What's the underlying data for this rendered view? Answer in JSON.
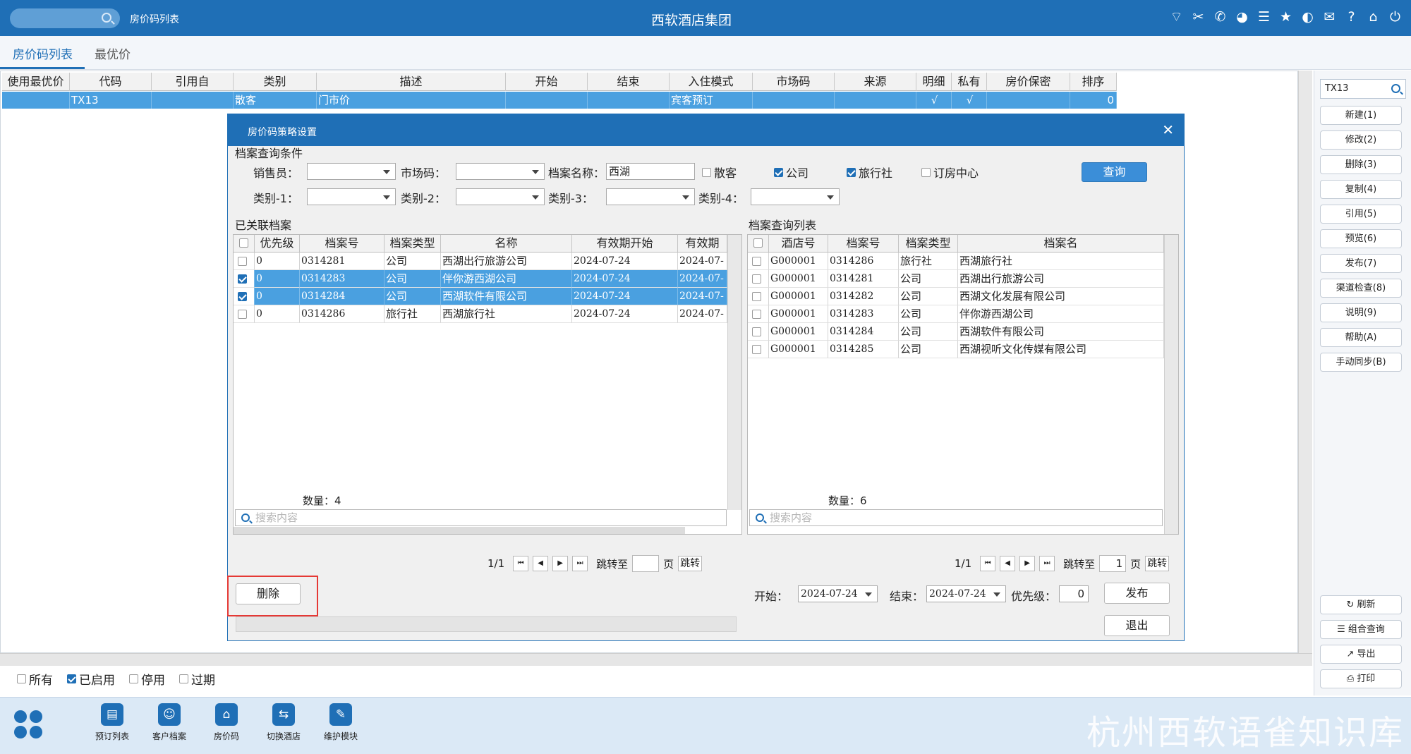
{
  "titlebar": {
    "tab": "房价码列表",
    "center_title": "西软酒店集团",
    "icons": [
      "wifi-icon",
      "tools-icon",
      "phone-icon",
      "palette-icon",
      "menu-icon",
      "star-icon",
      "moon-icon",
      "mail-icon",
      "help-icon",
      "home-icon",
      "power-icon"
    ]
  },
  "tabs": [
    "房价码列表",
    "最优价"
  ],
  "grid": {
    "headers": [
      "使用最优价",
      "代码",
      "引用自",
      "类别",
      "描述",
      "开始",
      "结束",
      "入住模式",
      "市场码",
      "来源",
      "明细",
      "私有",
      "房价保密",
      "排序"
    ],
    "row": [
      "",
      "TX13",
      "",
      "散客",
      "门市价",
      "",
      "",
      "宾客预订",
      "",
      "",
      "√",
      "√",
      "",
      "0"
    ]
  },
  "filters": [
    {
      "label": "所有",
      "checked": false
    },
    {
      "label": "已启用",
      "checked": true
    },
    {
      "label": "停用",
      "checked": false
    },
    {
      "label": "过期",
      "checked": false
    }
  ],
  "right": {
    "search": "TX13",
    "buttons": [
      "新建(1)",
      "修改(2)",
      "删除(3)",
      "复制(4)",
      "引用(5)",
      "预览(6)",
      "发布(7)",
      "渠道检查(8)",
      "说明(9)",
      "帮助(A)",
      "手动同步(B)"
    ],
    "bottom_buttons": [
      "刷新",
      "组合查询",
      "导出",
      "打印"
    ]
  },
  "dialog": {
    "title": "房价码策略设置",
    "query_section": "档案查询条件",
    "labels": {
      "salesman": "销售员：",
      "market": "市场码：",
      "archive_name": "档案名称：",
      "cat1": "类别-1：",
      "cat2": "类别-2：",
      "cat3": "类别-3：",
      "cat4": "类别-4："
    },
    "archive_name_value": "西湖",
    "checks": [
      {
        "label": "散客",
        "checked": false
      },
      {
        "label": "公司",
        "checked": true
      },
      {
        "label": "旅行社",
        "checked": true
      },
      {
        "label": "订房中心",
        "checked": false
      }
    ],
    "query_button": "查询",
    "left_panel": {
      "title": "已关联档案",
      "headers": [
        "优先级",
        "档案号",
        "档案类型",
        "名称",
        "有效期开始",
        "有效期"
      ],
      "rows": [
        {
          "checked": false,
          "selected": false,
          "cells": [
            "0",
            "0314281",
            "公司",
            "西湖出行旅游公司",
            "2024-07-24",
            "2024-07-"
          ]
        },
        {
          "checked": true,
          "selected": true,
          "cells": [
            "0",
            "0314283",
            "公司",
            "伴你游西湖公司",
            "2024-07-24",
            "2024-07-"
          ]
        },
        {
          "checked": true,
          "selected": true,
          "cells": [
            "0",
            "0314284",
            "公司",
            "西湖软件有限公司",
            "2024-07-24",
            "2024-07-"
          ]
        },
        {
          "checked": false,
          "selected": false,
          "cells": [
            "0",
            "0314286",
            "旅行社",
            "西湖旅行社",
            "2024-07-24",
            "2024-07-"
          ]
        }
      ],
      "count": "数量：4",
      "search_placeholder": "搜索内容",
      "page": "1/1",
      "goto": "跳转至",
      "page_unit": "页",
      "jump": "跳转",
      "page_input": ""
    },
    "right_panel": {
      "title": "档案查询列表",
      "headers": [
        "酒店号",
        "档案号",
        "档案类型",
        "档案名"
      ],
      "rows": [
        [
          "G000001",
          "0314286",
          "旅行社",
          "西湖旅行社"
        ],
        [
          "G000001",
          "0314281",
          "公司",
          "西湖出行旅游公司"
        ],
        [
          "G000001",
          "0314282",
          "公司",
          "西湖文化发展有限公司"
        ],
        [
          "G000001",
          "0314283",
          "公司",
          "伴你游西湖公司"
        ],
        [
          "G000001",
          "0314284",
          "公司",
          "西湖软件有限公司"
        ],
        [
          "G000001",
          "0314285",
          "公司",
          "西湖视听文化传媒有限公司"
        ]
      ],
      "count": "数量：6",
      "search_placeholder": "搜索内容",
      "page": "1/1",
      "goto": "跳转至",
      "page_input": "1",
      "page_unit": "页",
      "jump": "跳转"
    },
    "delete_button": "删除",
    "start_label": "开始：",
    "start_value": "2024-07-24",
    "end_label": "结束：",
    "end_value": "2024-07-24",
    "priority_label": "优先级：",
    "priority_value": "0",
    "publish_button": "发布",
    "exit_button": "退出"
  },
  "bottombar": {
    "modules": [
      "预订列表",
      "客户档案",
      "房价码",
      "切换酒店",
      "维护模块"
    ],
    "watermark": "杭州西软语雀知识库"
  },
  "colors": {
    "primary": "#1f6fb6",
    "selection": "#4aa0e0",
    "highlight_box": "#e53935"
  }
}
